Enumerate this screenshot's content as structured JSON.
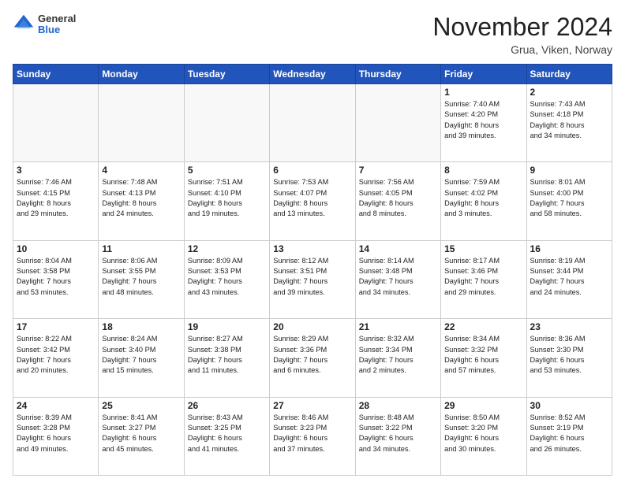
{
  "header": {
    "logo_line1": "General",
    "logo_line2": "Blue",
    "month": "November 2024",
    "location": "Grua, Viken, Norway"
  },
  "weekdays": [
    "Sunday",
    "Monday",
    "Tuesday",
    "Wednesday",
    "Thursday",
    "Friday",
    "Saturday"
  ],
  "weeks": [
    [
      {
        "day": "",
        "info": ""
      },
      {
        "day": "",
        "info": ""
      },
      {
        "day": "",
        "info": ""
      },
      {
        "day": "",
        "info": ""
      },
      {
        "day": "",
        "info": ""
      },
      {
        "day": "1",
        "info": "Sunrise: 7:40 AM\nSunset: 4:20 PM\nDaylight: 8 hours\nand 39 minutes."
      },
      {
        "day": "2",
        "info": "Sunrise: 7:43 AM\nSunset: 4:18 PM\nDaylight: 8 hours\nand 34 minutes."
      }
    ],
    [
      {
        "day": "3",
        "info": "Sunrise: 7:46 AM\nSunset: 4:15 PM\nDaylight: 8 hours\nand 29 minutes."
      },
      {
        "day": "4",
        "info": "Sunrise: 7:48 AM\nSunset: 4:13 PM\nDaylight: 8 hours\nand 24 minutes."
      },
      {
        "day": "5",
        "info": "Sunrise: 7:51 AM\nSunset: 4:10 PM\nDaylight: 8 hours\nand 19 minutes."
      },
      {
        "day": "6",
        "info": "Sunrise: 7:53 AM\nSunset: 4:07 PM\nDaylight: 8 hours\nand 13 minutes."
      },
      {
        "day": "7",
        "info": "Sunrise: 7:56 AM\nSunset: 4:05 PM\nDaylight: 8 hours\nand 8 minutes."
      },
      {
        "day": "8",
        "info": "Sunrise: 7:59 AM\nSunset: 4:02 PM\nDaylight: 8 hours\nand 3 minutes."
      },
      {
        "day": "9",
        "info": "Sunrise: 8:01 AM\nSunset: 4:00 PM\nDaylight: 7 hours\nand 58 minutes."
      }
    ],
    [
      {
        "day": "10",
        "info": "Sunrise: 8:04 AM\nSunset: 3:58 PM\nDaylight: 7 hours\nand 53 minutes."
      },
      {
        "day": "11",
        "info": "Sunrise: 8:06 AM\nSunset: 3:55 PM\nDaylight: 7 hours\nand 48 minutes."
      },
      {
        "day": "12",
        "info": "Sunrise: 8:09 AM\nSunset: 3:53 PM\nDaylight: 7 hours\nand 43 minutes."
      },
      {
        "day": "13",
        "info": "Sunrise: 8:12 AM\nSunset: 3:51 PM\nDaylight: 7 hours\nand 39 minutes."
      },
      {
        "day": "14",
        "info": "Sunrise: 8:14 AM\nSunset: 3:48 PM\nDaylight: 7 hours\nand 34 minutes."
      },
      {
        "day": "15",
        "info": "Sunrise: 8:17 AM\nSunset: 3:46 PM\nDaylight: 7 hours\nand 29 minutes."
      },
      {
        "day": "16",
        "info": "Sunrise: 8:19 AM\nSunset: 3:44 PM\nDaylight: 7 hours\nand 24 minutes."
      }
    ],
    [
      {
        "day": "17",
        "info": "Sunrise: 8:22 AM\nSunset: 3:42 PM\nDaylight: 7 hours\nand 20 minutes."
      },
      {
        "day": "18",
        "info": "Sunrise: 8:24 AM\nSunset: 3:40 PM\nDaylight: 7 hours\nand 15 minutes."
      },
      {
        "day": "19",
        "info": "Sunrise: 8:27 AM\nSunset: 3:38 PM\nDaylight: 7 hours\nand 11 minutes."
      },
      {
        "day": "20",
        "info": "Sunrise: 8:29 AM\nSunset: 3:36 PM\nDaylight: 7 hours\nand 6 minutes."
      },
      {
        "day": "21",
        "info": "Sunrise: 8:32 AM\nSunset: 3:34 PM\nDaylight: 7 hours\nand 2 minutes."
      },
      {
        "day": "22",
        "info": "Sunrise: 8:34 AM\nSunset: 3:32 PM\nDaylight: 6 hours\nand 57 minutes."
      },
      {
        "day": "23",
        "info": "Sunrise: 8:36 AM\nSunset: 3:30 PM\nDaylight: 6 hours\nand 53 minutes."
      }
    ],
    [
      {
        "day": "24",
        "info": "Sunrise: 8:39 AM\nSunset: 3:28 PM\nDaylight: 6 hours\nand 49 minutes."
      },
      {
        "day": "25",
        "info": "Sunrise: 8:41 AM\nSunset: 3:27 PM\nDaylight: 6 hours\nand 45 minutes."
      },
      {
        "day": "26",
        "info": "Sunrise: 8:43 AM\nSunset: 3:25 PM\nDaylight: 6 hours\nand 41 minutes."
      },
      {
        "day": "27",
        "info": "Sunrise: 8:46 AM\nSunset: 3:23 PM\nDaylight: 6 hours\nand 37 minutes."
      },
      {
        "day": "28",
        "info": "Sunrise: 8:48 AM\nSunset: 3:22 PM\nDaylight: 6 hours\nand 34 minutes."
      },
      {
        "day": "29",
        "info": "Sunrise: 8:50 AM\nSunset: 3:20 PM\nDaylight: 6 hours\nand 30 minutes."
      },
      {
        "day": "30",
        "info": "Sunrise: 8:52 AM\nSunset: 3:19 PM\nDaylight: 6 hours\nand 26 minutes."
      }
    ]
  ]
}
